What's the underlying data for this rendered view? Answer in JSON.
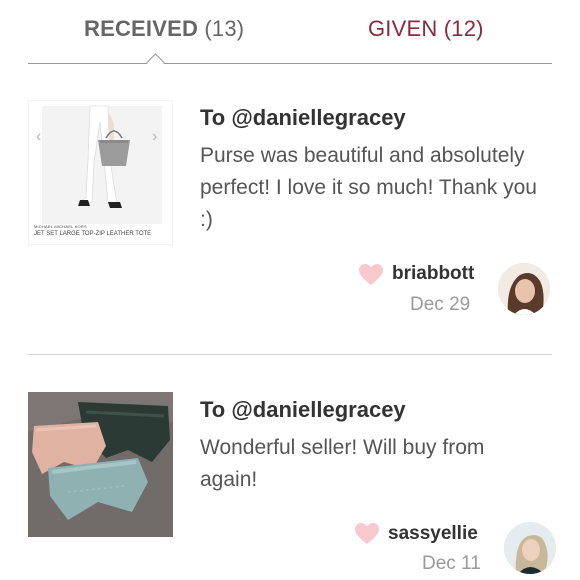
{
  "tabs": {
    "received_label": "RECEIVED",
    "received_count": "(13)",
    "given_label": "GIVEN (12)"
  },
  "reviews": [
    {
      "to": "To @daniellegracey",
      "text": "Purse was beautiful and absolutely perfect! I love it so much! Thank you :)",
      "username": "briabbott",
      "date": "Dec 29",
      "thumb_brand": "MICHAEL MICHAEL KORS",
      "thumb_caption": "JET SET LARGE TOP-ZIP LEATHER TOTE",
      "thumb_prev": "‹",
      "thumb_next": "›"
    },
    {
      "to": "To @daniellegracey",
      "text": "Wonderful seller! Will buy from again!",
      "username": "sassyellie",
      "date": "Dec 11"
    }
  ],
  "colors": {
    "given_tab": "#8a2a3a",
    "heart": "#f7c9cf"
  }
}
